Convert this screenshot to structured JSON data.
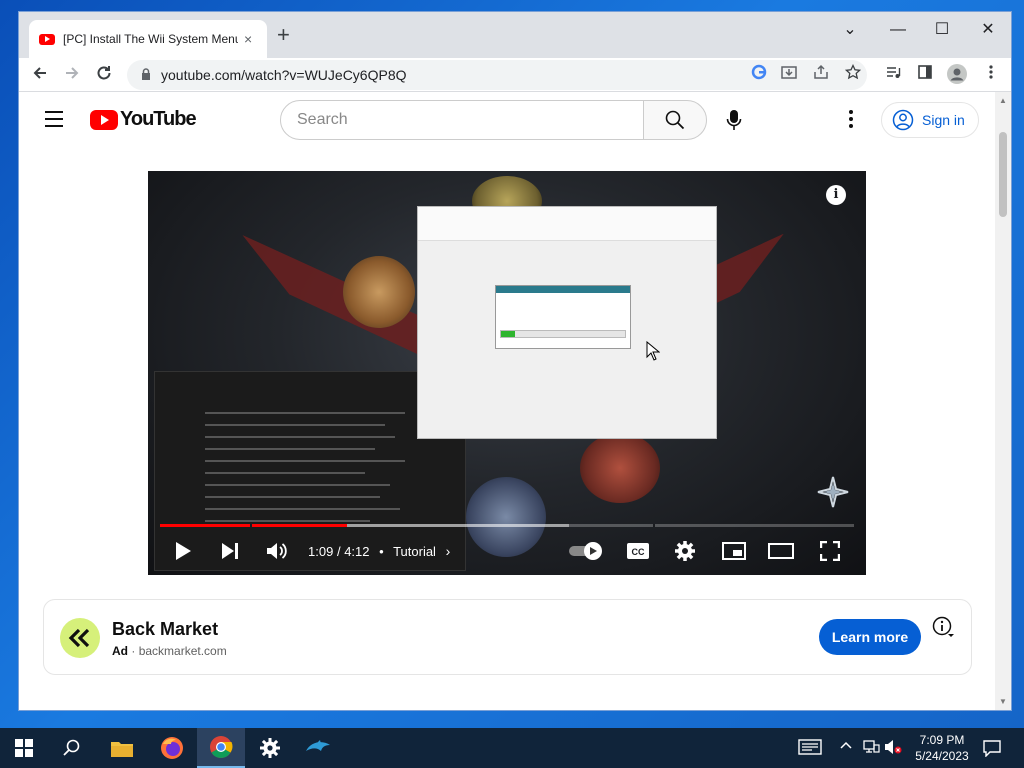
{
  "browser": {
    "tab_title": "[PC] Install The Wii System Menu",
    "tab_close": "×",
    "new_tab": "+",
    "url": "youtube.com/watch?v=WUJeCy6QP8Q",
    "window_controls": [
      "⌄",
      "—",
      "☐",
      "✕"
    ]
  },
  "youtube": {
    "logo_text": "YouTube",
    "search_placeholder": "Search",
    "sign_in": "Sign in"
  },
  "player": {
    "progress": {
      "played": 0.27,
      "loaded": 0.59,
      "chapter_marks": [
        0.13,
        0.71
      ]
    },
    "current_time": "1:09",
    "separator": "/",
    "duration": "4:12",
    "chapter_bullet": "•",
    "chapter": "Tutorial",
    "chapter_chevron": "›",
    "info_icon": "i"
  },
  "ad": {
    "name": "Back Market",
    "tag": "Ad",
    "separator": "·",
    "domain": "backmarket.com",
    "cta": "Learn more"
  },
  "taskbar": {
    "time": "7:09 PM",
    "date": "5/24/2023"
  },
  "colors": {
    "youtube_red": "#ff0000",
    "link_blue": "#065fd4",
    "progress_red": "#ff0000"
  }
}
